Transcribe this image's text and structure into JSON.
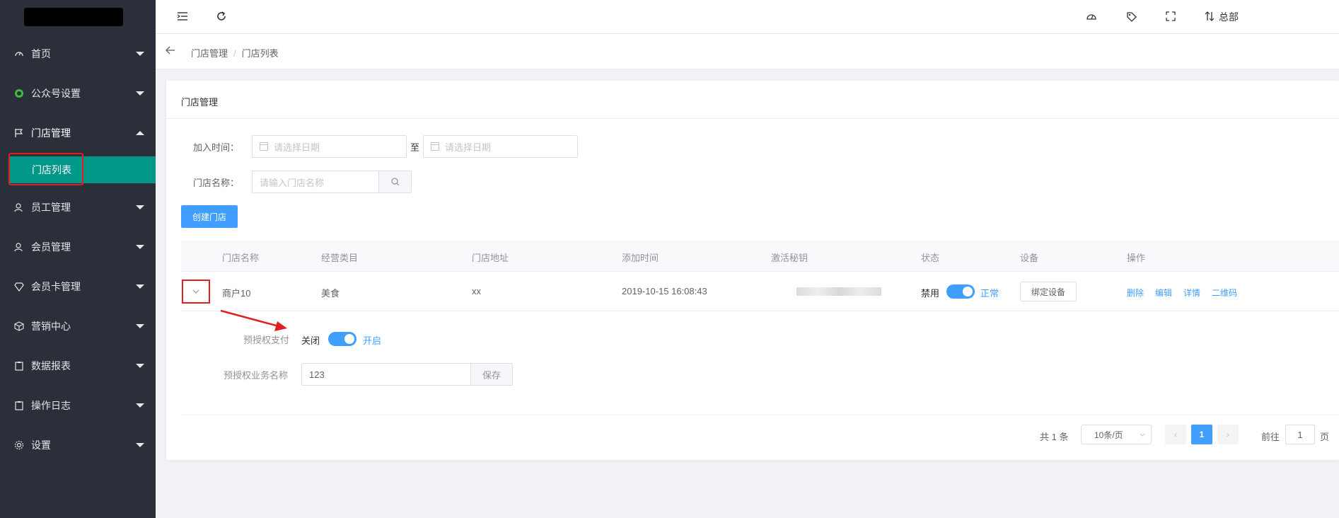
{
  "sidebar": {
    "items": [
      {
        "label": "首页",
        "icon": "gauge-icon"
      },
      {
        "label": "公众号设置",
        "icon": "wechat-icon"
      },
      {
        "label": "门店管理",
        "icon": "flag-icon"
      },
      {
        "label": "员工管理",
        "icon": "user-icon"
      },
      {
        "label": "会员管理",
        "icon": "user-icon"
      },
      {
        "label": "会员卡管理",
        "icon": "diamond-icon"
      },
      {
        "label": "营销中心",
        "icon": "cube-icon"
      },
      {
        "label": "数据报表",
        "icon": "clipboard-icon"
      },
      {
        "label": "操作日志",
        "icon": "clipboard-icon"
      },
      {
        "label": "设置",
        "icon": "gear-icon"
      }
    ],
    "active_sub": "门店列表"
  },
  "header": {
    "branch": "总部"
  },
  "breadcrumb": [
    "门店管理",
    "门店列表"
  ],
  "card": {
    "title": "门店管理",
    "filters": {
      "join_time_label": "加入时间：",
      "date_placeholder": "请选择日期",
      "to": "至",
      "store_name_label": "门店名称：",
      "store_name_placeholder": "请输入门店名称"
    },
    "create_btn": "创建门店",
    "table": {
      "headers": [
        "门店名称",
        "经营类目",
        "门店地址",
        "添加时间",
        "激活秘钥",
        "状态",
        "设备",
        "操作"
      ],
      "rows": [
        {
          "name": "商户10",
          "category": "美食",
          "address": "xx",
          "added": "2019-10-15 16:08:43",
          "status_off": "禁用",
          "status_on": "正常",
          "device_btn": "绑定设备",
          "actions": [
            "删除",
            "编辑",
            "详情",
            "二维码"
          ]
        }
      ]
    },
    "expanded": {
      "preauth_label": "预授权支付",
      "off": "关闭",
      "on": "开启",
      "biz_name_label": "预授权业务名称",
      "biz_name_value": "123",
      "save_btn": "保存"
    },
    "pagination": {
      "total": "共 1 条",
      "page_size": "10条/页",
      "current": "1",
      "goto_prefix": "前往",
      "goto_value": "1",
      "goto_suffix": "页"
    }
  },
  "colors": {
    "sidebar_bg": "#2b2f3a",
    "active_sub_bg": "#009688",
    "primary": "#409eff",
    "highlight": "#e02020"
  }
}
